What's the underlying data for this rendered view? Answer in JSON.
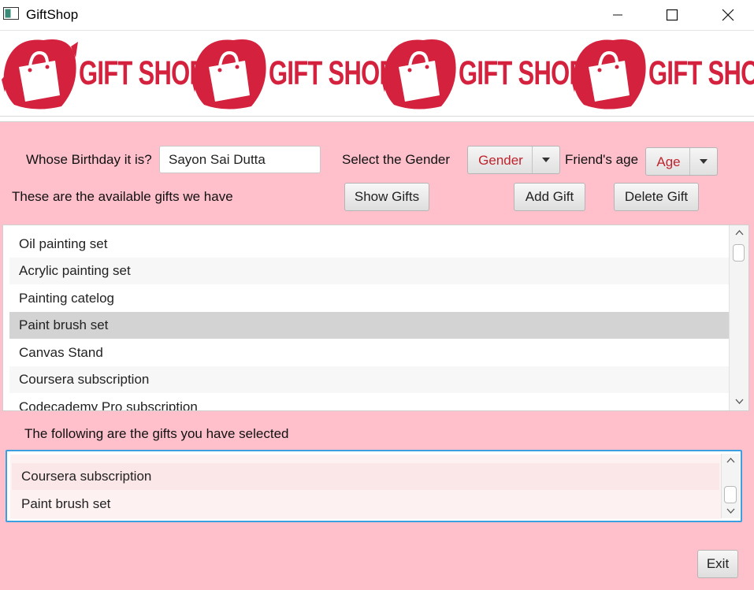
{
  "window": {
    "title": "GiftShop",
    "controls": [
      "minimize",
      "maximize",
      "close"
    ]
  },
  "banner": {
    "logo_text": "GIFT SHOP",
    "brand_color": "#d4213d"
  },
  "form": {
    "birthday_label": "Whose Birthday it is?",
    "name_value": "Sayon Sai Dutta",
    "gender_label": "Select the Gender",
    "gender_selected": "Gender",
    "age_label": "Friend's age",
    "age_selected": "Age",
    "available_label": "These are the available gifts we have",
    "show_gifts": "Show Gifts",
    "add_gift": "Add Gift",
    "delete_gift": "Delete Gift"
  },
  "available_gifts": {
    "items": [
      "Oil painting set",
      "Acrylic painting set",
      "Painting catelog",
      "Paint brush set",
      "Canvas Stand",
      "Coursera subscription",
      "Codecademy Pro subscription"
    ],
    "selected_index": 3
  },
  "selected_section": {
    "label": "The following are the gifts you have selected",
    "items": [
      "Coursera subscription",
      "Paint brush set"
    ]
  },
  "footer": {
    "exit": "Exit"
  },
  "colors": {
    "background": "#ffc0cb",
    "accent_text": "#c0232d",
    "selection": "#d3d3d3",
    "focus_border": "#3b9fe0"
  }
}
